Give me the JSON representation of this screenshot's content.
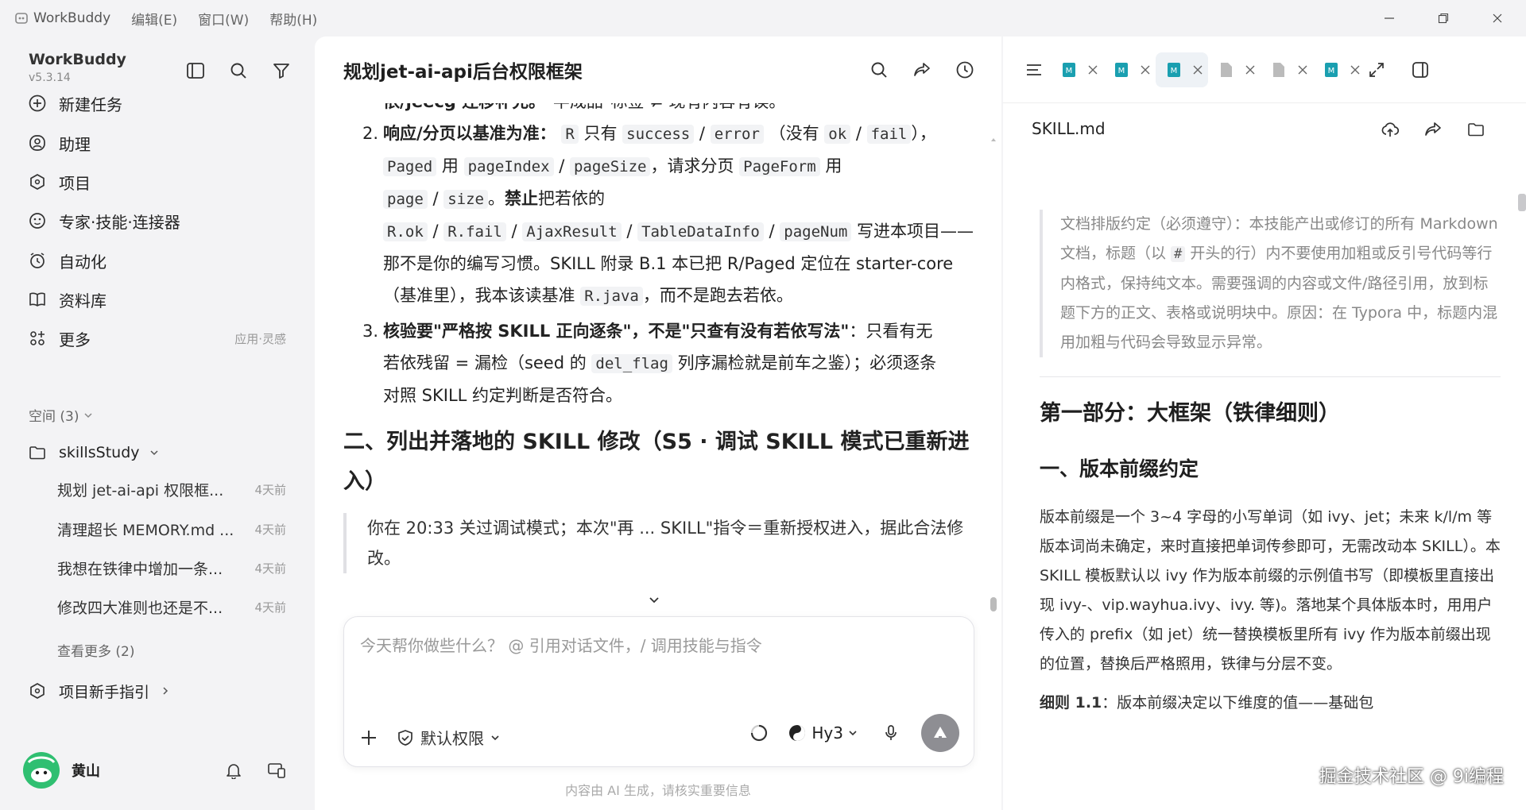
{
  "titlebar": {
    "app_name": "WorkBuddy",
    "menus": [
      "编辑(E)",
      "窗口(W)",
      "帮助(H)"
    ]
  },
  "sidebar": {
    "brand": "WorkBuddy",
    "version": "v5.3.14",
    "nav": [
      {
        "label": "新建任务",
        "icon": "plus-circle-icon"
      },
      {
        "label": "助理",
        "icon": "assistant-icon"
      },
      {
        "label": "项目",
        "icon": "project-icon"
      },
      {
        "label": "专家·技能·连接器",
        "icon": "expert-icon"
      },
      {
        "label": "自动化",
        "icon": "alarm-icon"
      },
      {
        "label": "资料库",
        "icon": "book-icon"
      },
      {
        "label": "更多",
        "icon": "grid-icon",
        "sub": "应用·灵感"
      }
    ],
    "spaces_label": "空间 (3)",
    "folder": "skillsStudy",
    "tasks": [
      {
        "title": "规划 jet-ai-api 权限框...",
        "age": "4天前"
      },
      {
        "title": "清理超长 MEMORY.md ...",
        "age": "4天前"
      },
      {
        "title": "我想在铁律中增加一条...",
        "age": "4天前"
      },
      {
        "title": "修改四大准则也还是不...",
        "age": "4天前"
      }
    ],
    "see_more": "查看更多 (2)",
    "guide": "项目新手指引",
    "user": "黄山"
  },
  "chat": {
    "title": "规划jet-ai-api后台权限框架",
    "top_line_bold": "依/jeecg 迁移补充。",
    "top_line_rest": "\"半成品\"标签 ≠ 现有内容有误。",
    "item2": {
      "num": "2.",
      "bold": "响应/分页以基准为准",
      "t1": "：",
      "c_R": "R",
      "t2": " 只有 ",
      "c_success": "success",
      "c_error": "error",
      "t3": " （没有 ",
      "c_ok": "ok",
      "c_fail": "fail",
      "t4": "），",
      "c_Paged": "Paged",
      "t5": " 用 ",
      "c_pageIndex": "pageIndex",
      "c_pageSize": "pageSize",
      "t6": "，请求分页 ",
      "c_PageForm": "PageForm",
      "t7": " 用",
      "c_page": "page",
      "c_size": "size",
      "t8": "。",
      "bold2": "禁止",
      "t9": "把若依的",
      "c_Rok": "R.ok",
      "c_Rfail": "R.fail",
      "c_Ajax": "AjaxResult",
      "c_Table": "TableDataInfo",
      "c_pageNum": "pageNum",
      "t10": " 写进本项目——",
      "t11": "那不是你的编写习惯。SKILL 附录 B.1 本已把 R/Paged 定位在 starter-core",
      "t12": "（基准里），我本该读基准 ",
      "c_Rjava": "R.java",
      "t13": "，而不是跑去若依。"
    },
    "item3": {
      "num": "3.",
      "bold": "核验要\"严格按 SKILL 正向逐条\"，不是\"只查有没有若依写法\"",
      "t1": "：只看有无",
      "t2": "若依残留 = 漏检（seed 的 ",
      "c_del": "del_flag",
      "t3": " 列序漏检就是前车之鉴）；必须逐条",
      "t4": "对照 SKILL 约定判断是否符合。"
    },
    "heading": "二、列出并落地的 SKILL 修改（S5 · 调试 SKILL 模式已重新进入）",
    "quote": "你在 20:33 关过调试模式；本次\"再 ... SKILL\"指令＝重新授权进入，据此合法修改。",
    "composer_placeholder": "今天帮你做些什么？ @ 引用对话文件，/ 调用技能与指令",
    "permission": "默认权限",
    "model": "Hy3",
    "disclaimer": "内容由 AI 生成，请核实重要信息"
  },
  "doc": {
    "filename": "SKILL.md",
    "note_1": "文档排版约定（必须遵守）：本技能产出或修订的所有 Markdown 文档，标题（以 ",
    "note_code": "#",
    "note_2": " 开头的行）内不要使用加粗或反引号代码等行内格式，保持纯文本。需要强调的内容或文件/路径引用，放到标题下方的正文、表格或说明块中。原因：在 Typora 中，标题内混用加粗与代码会导致显示异常。",
    "h1": "第一部分：大框架（铁律细则）",
    "h2": "一、版本前缀约定",
    "para": "版本前缀是一个 3~4 字母的小写单词（如 ivy、jet；未来 k/l/m 等版本词尚未确定，来时直接把单词传参即可，无需改动本 SKILL）。本 SKILL 模板默认以 ivy 作为版本前缀的示例值书写（即模板里直接出现 ivy-、vip.wayhua.ivy、ivy. 等)。落地某个具体版本时，用用户传入的 prefix（如 jet）统一替换模板里所有 ivy 作为版本前缀出现的位置，替换后严格照用，铁律与分层不变。",
    "rule_bold": "细则 1.1",
    "rule_rest": "：版本前缀决定以下维度的值——基础包",
    "watermark": "掘金技术社区 @ 9i编程"
  }
}
